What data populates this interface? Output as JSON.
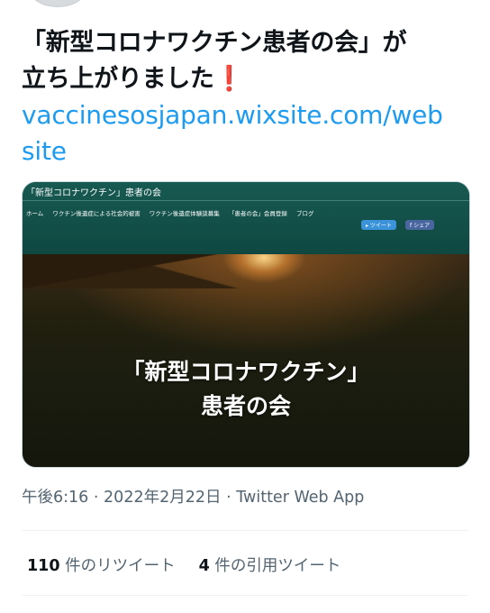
{
  "tweet": {
    "line1": "「新型コロナワクチン患者の会」が",
    "line2": "立ち上がりました",
    "link_line1": "vaccinesosjapan.wixsite.com/web",
    "link_line2": "site"
  },
  "card": {
    "site_title": "「新型コロナワクチン」患者の会",
    "nav": [
      "ホーム",
      "ワクチン後遺症による社会的被害",
      "ワクチン後遺症体験談募集",
      "「患者の会」会員登録",
      "ブログ"
    ],
    "share_tweet": "ツイート",
    "share_facebook": "シェア",
    "hero_line1": "「新型コロナワクチン」",
    "hero_line2": "患者の会"
  },
  "meta": {
    "time": "午後6:16",
    "date": "2022年2月22日",
    "source": "Twitter Web App",
    "separator": "·"
  },
  "stats": {
    "retweets_count": "110",
    "retweets_label": "件のリツイート",
    "quotes_count": "4",
    "quotes_label": "件の引用ツイート"
  },
  "colors": {
    "link": "#1d9bf0",
    "secondary_text": "#536471",
    "emoji_red": "#dd2e44",
    "site_header": "#175a52"
  },
  "icons": {
    "exclamation": "heavy-exclamation-mark-icon"
  }
}
